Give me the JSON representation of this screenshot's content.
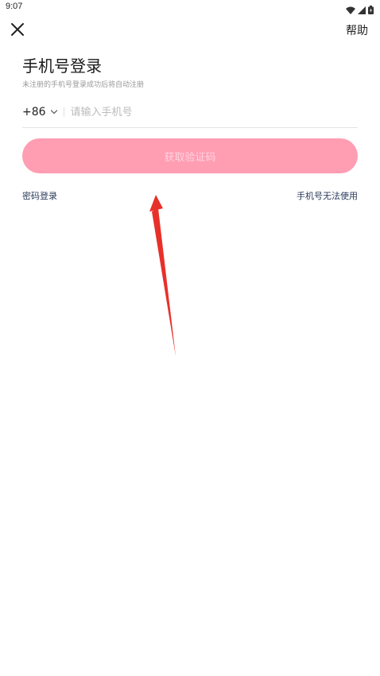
{
  "status_bar": {
    "time": "9:07",
    "icons": [
      "wifi-icon",
      "signal-icon",
      "battery-icon"
    ]
  },
  "header": {
    "close_icon": "close-icon",
    "help_label": "帮助"
  },
  "main": {
    "title": "手机号登录",
    "subtitle": "未注册的手机号登录成功后将自动注册",
    "country_code": "+86",
    "phone_placeholder": "请输入手机号",
    "phone_value": "",
    "get_code_label": "获取验证码",
    "password_login_label": "密码登录",
    "phone_unusable_label": "手机号无法使用"
  },
  "colors": {
    "button_bg": "#ff9db3",
    "button_text": "#ffd3dd",
    "link_text": "#2b3a5a",
    "annotation_arrow": "#e8302a"
  }
}
